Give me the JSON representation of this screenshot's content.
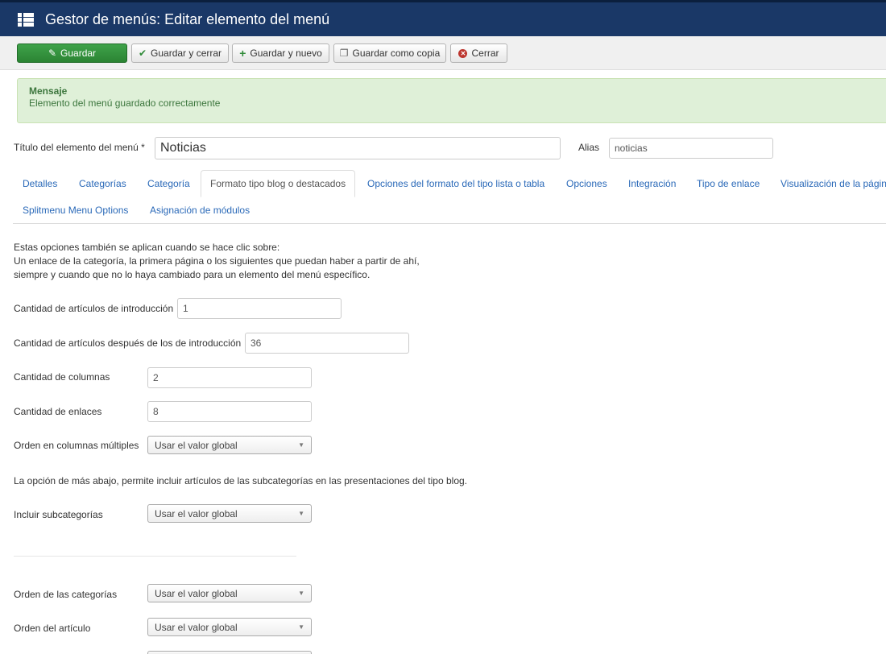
{
  "header": {
    "title": "Gestor de menús: Editar elemento del menú",
    "icon": "list-icon"
  },
  "toolbar": {
    "save": "Guardar",
    "save_close": "Guardar y cerrar",
    "save_new": "Guardar y nuevo",
    "save_copy": "Guardar como copia",
    "close": "Cerrar"
  },
  "message": {
    "heading": "Mensaje",
    "text": "Elemento del menú guardado correctamente"
  },
  "title_field": {
    "label": "Título del elemento del menú *",
    "value": "Noticias"
  },
  "alias_field": {
    "label": "Alias",
    "value": "noticias"
  },
  "tabs": [
    "Detalles",
    "Categorías",
    "Categoría",
    "Formato tipo blog o destacados",
    "Opciones del formato del tipo lista o tabla",
    "Opciones",
    "Integración",
    "Tipo de enlace",
    "Visualización de la págin",
    "Splitmenu Menu Options",
    "Asignación de módulos"
  ],
  "intro": {
    "line1": "Estas opciones también se aplican cuando se hace clic sobre:",
    "line2": "Un enlace de la categoría, la primera página o los siguientes que puedan haber a partir de ahí,",
    "line3": "siempre y cuando que no lo haya cambiado para un elemento del menú específico."
  },
  "fields": {
    "intro_articles": {
      "label": "Cantidad de artículos de introducción",
      "value": "1"
    },
    "after_intro": {
      "label": "Cantidad de artículos después de los de introducción",
      "value": "36"
    },
    "columns": {
      "label": "Cantidad de columnas",
      "value": "2"
    },
    "links": {
      "label": "Cantidad de enlaces",
      "value": "8"
    },
    "multi_column_order": {
      "label": "Orden en columnas múltiples",
      "value": "Usar el valor global"
    },
    "subcat_note": "La opción de más abajo, permite incluir artículos de las subcategorías en las presentaciones del tipo blog.",
    "include_subcats": {
      "label": "Incluir subcategorías",
      "value": "Usar el valor global"
    },
    "category_order": {
      "label": "Orden de las categorías",
      "value": "Usar el valor global"
    },
    "article_order": {
      "label": "Orden del artículo",
      "value": "Usar el valor global"
    }
  }
}
